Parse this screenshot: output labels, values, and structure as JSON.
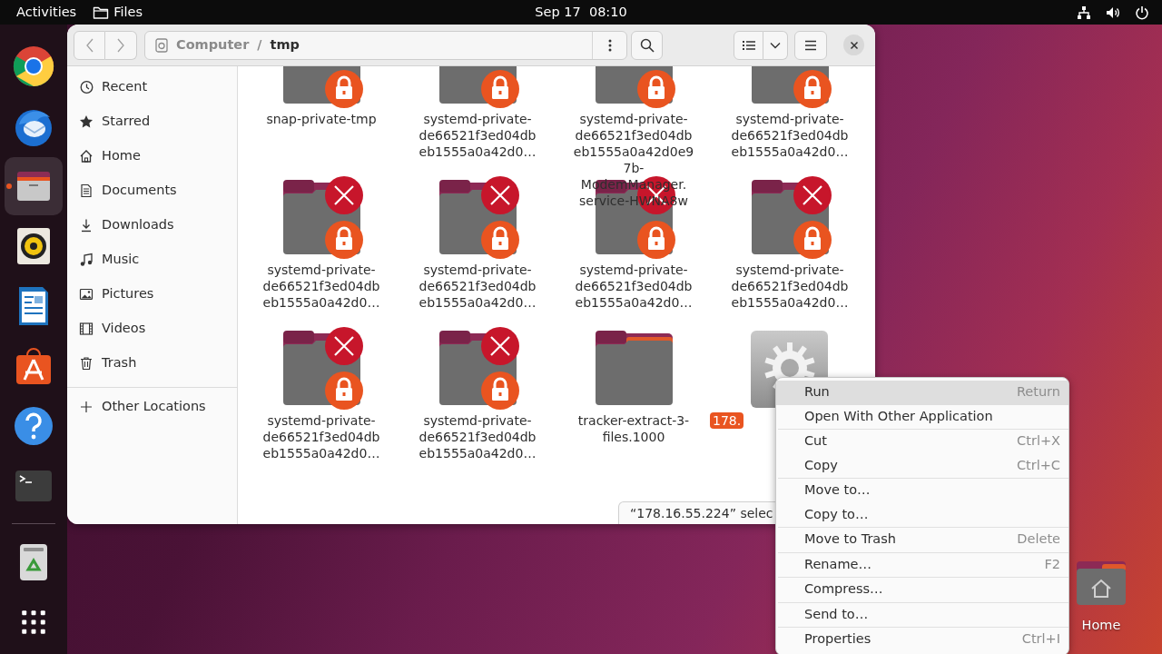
{
  "top_bar": {
    "activities": "Activities",
    "app_name": "Files",
    "clock": "Sep 17  08:10"
  },
  "dock": [
    {
      "kind": "browser",
      "active": false
    },
    {
      "kind": "mail",
      "active": false
    },
    {
      "kind": "files",
      "active": true
    },
    {
      "kind": "speaker",
      "active": false
    },
    {
      "kind": "document",
      "active": false
    },
    {
      "kind": "store",
      "active": false
    },
    {
      "kind": "help",
      "active": false
    },
    {
      "kind": "terminal",
      "active": false
    },
    {
      "kind": "separator",
      "active": false
    },
    {
      "kind": "trash",
      "active": false
    },
    {
      "kind": "apps",
      "active": false
    }
  ],
  "window": {
    "path": [
      {
        "label": "Computer",
        "current": false
      },
      {
        "label": "tmp",
        "current": true
      }
    ],
    "path_separator": "/",
    "sidebar": [
      {
        "kind": "recent",
        "label": "Recent"
      },
      {
        "kind": "starred",
        "label": "Starred"
      },
      {
        "kind": "home",
        "label": "Home"
      },
      {
        "kind": "documents",
        "label": "Documents"
      },
      {
        "kind": "downloads",
        "label": "Downloads"
      },
      {
        "kind": "music",
        "label": "Music"
      },
      {
        "kind": "pictures",
        "label": "Pictures"
      },
      {
        "kind": "videos",
        "label": "Videos"
      },
      {
        "kind": "trash",
        "label": "Trash"
      },
      {
        "kind": "other",
        "label": "Other Locations"
      }
    ],
    "files": [
      {
        "kind": "restricted-folder",
        "lines": [
          "snap-private-tmp"
        ],
        "selected": false
      },
      {
        "kind": "restricted-folder",
        "lines": [
          "systemd-private-",
          "de66521f3ed04db",
          "eb1555a0a42d0…"
        ],
        "selected": false
      },
      {
        "kind": "restricted-folder",
        "lines": [
          "systemd-private-",
          "de66521f3ed04db",
          "eb1555a0a42d0e9",
          "7b-",
          "ModemManager.",
          "service-HWNA8w"
        ],
        "selected": false
      },
      {
        "kind": "restricted-folder",
        "lines": [
          "systemd-private-",
          "de66521f3ed04db",
          "eb1555a0a42d0…"
        ],
        "selected": false
      },
      {
        "kind": "restricted-folder",
        "lines": [
          "systemd-private-",
          "de66521f3ed04db",
          "eb1555a0a42d0…"
        ],
        "selected": false
      },
      {
        "kind": "restricted-folder",
        "lines": [
          "systemd-private-",
          "de66521f3ed04db",
          "eb1555a0a42d0…"
        ],
        "selected": false
      },
      {
        "kind": "restricted-folder",
        "lines": [
          "systemd-private-",
          "de66521f3ed04db",
          "eb1555a0a42d0…"
        ],
        "selected": false
      },
      {
        "kind": "restricted-folder",
        "lines": [
          "systemd-private-",
          "de66521f3ed04db",
          "eb1555a0a42d0…"
        ],
        "selected": false
      },
      {
        "kind": "restricted-folder",
        "lines": [
          "systemd-private-",
          "de66521f3ed04db",
          "eb1555a0a42d0…"
        ],
        "selected": false
      },
      {
        "kind": "restricted-folder",
        "lines": [
          "systemd-private-",
          "de66521f3ed04db",
          "eb1555a0a42d0…"
        ],
        "selected": false
      },
      {
        "kind": "folder",
        "lines": [
          "tracker-extract-3-",
          "files.1000"
        ],
        "selected": false
      },
      {
        "kind": "executable",
        "lines": [
          "178."
        ],
        "selected": true
      }
    ],
    "status": "“178.16.55.224” selec"
  },
  "context_menu": [
    [
      {
        "label": "Run",
        "shortcut": "Return",
        "highlighted": true
      },
      {
        "label": "Open With Other Application",
        "highlighted": false
      }
    ],
    [
      {
        "label": "Cut",
        "shortcut": "Ctrl+X",
        "highlighted": false
      },
      {
        "label": "Copy",
        "shortcut": "Ctrl+C",
        "highlighted": false
      }
    ],
    [
      {
        "label": "Move to…",
        "highlighted": false
      },
      {
        "label": "Copy to…",
        "highlighted": false
      }
    ],
    [
      {
        "label": "Move to Trash",
        "shortcut": "Delete",
        "highlighted": false
      }
    ],
    [
      {
        "label": "Rename…",
        "shortcut": "F2",
        "highlighted": false
      }
    ],
    [
      {
        "label": "Compress…",
        "highlighted": false
      }
    ],
    [
      {
        "label": "Send to…",
        "highlighted": false
      }
    ],
    [
      {
        "label": "Properties",
        "shortcut": "Ctrl+I",
        "highlighted": false
      }
    ]
  ],
  "desktop_icons": [
    {
      "label": "Home"
    }
  ]
}
